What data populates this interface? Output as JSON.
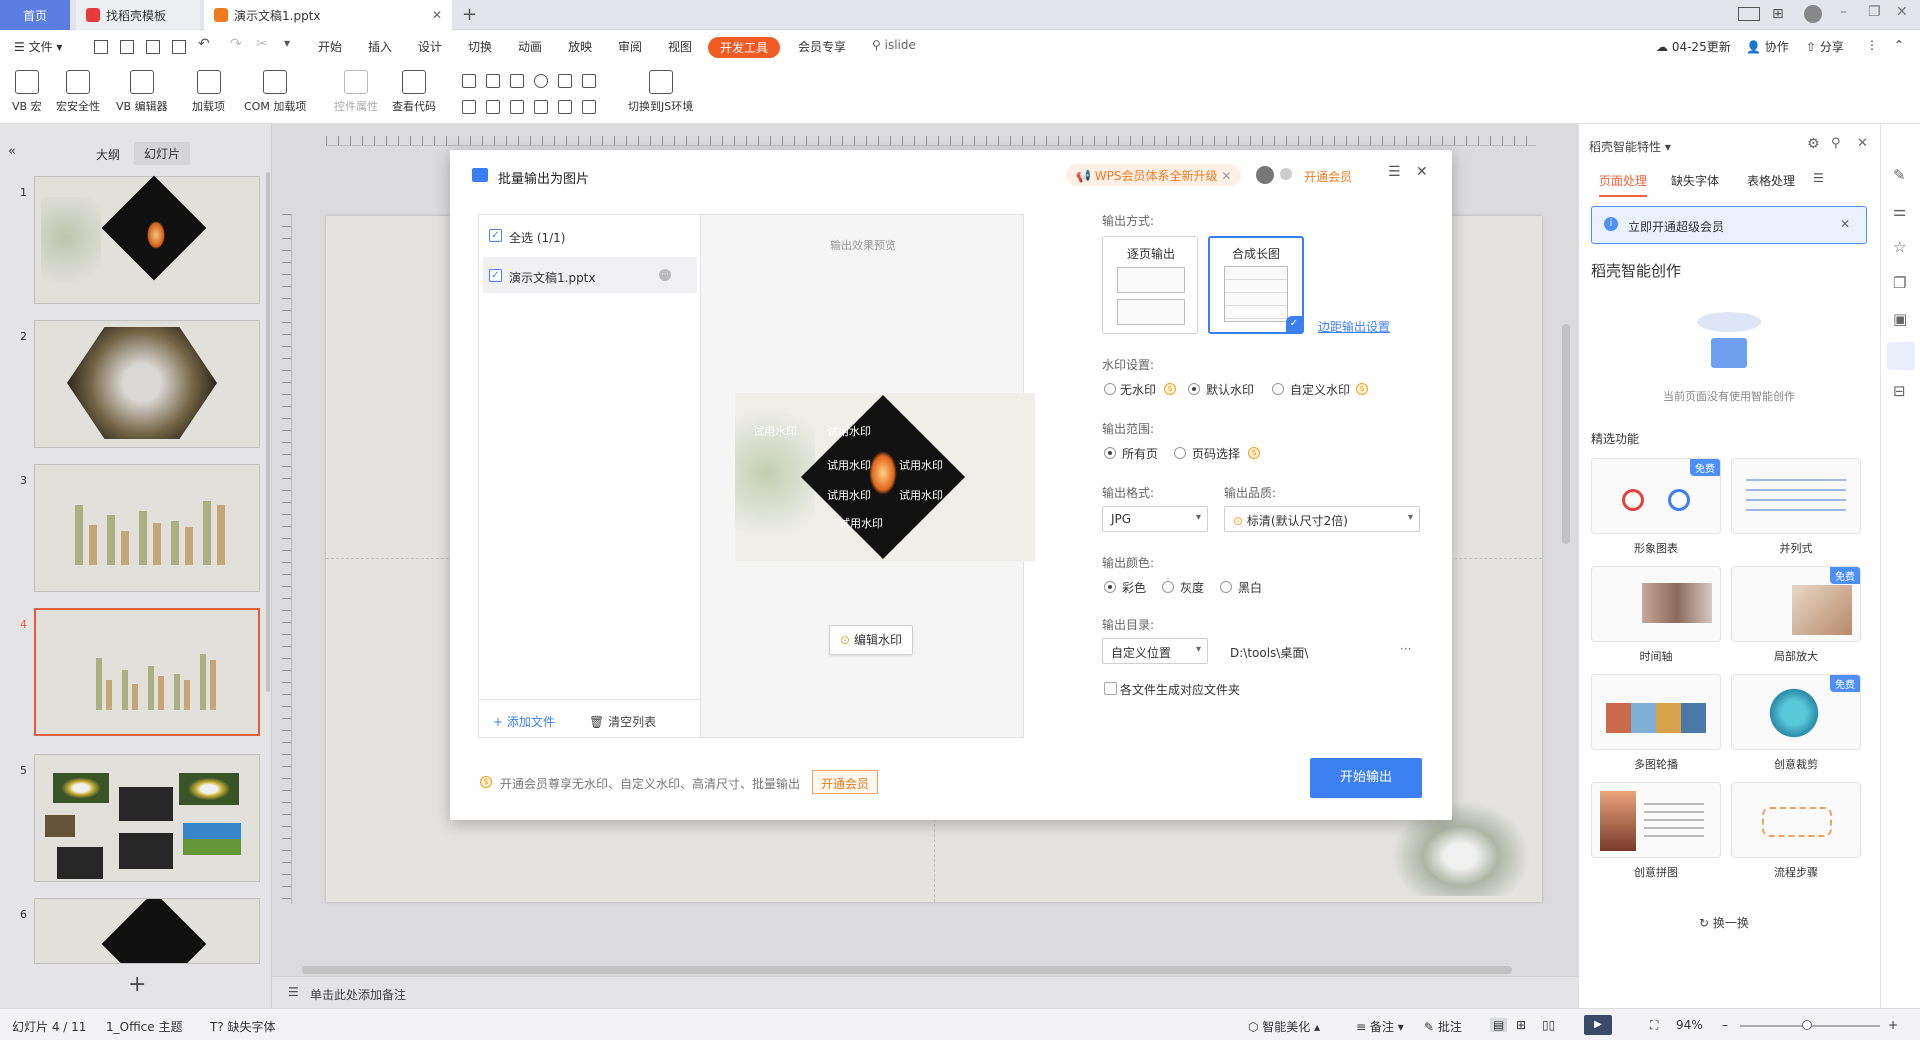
{
  "tabs": {
    "home": "首页",
    "template": "找稻壳模板",
    "doc": "演示文稿1.pptx",
    "add": "+"
  },
  "menu": {
    "file": "文件",
    "items": [
      "开始",
      "插入",
      "设计",
      "切换",
      "动画",
      "放映",
      "审阅",
      "视图"
    ],
    "active": "开发工具",
    "member": "会员专享",
    "search": "islide",
    "update": "04-25更新",
    "collab": "协作",
    "share": "分享"
  },
  "toolbar": {
    "vb_macro": "VB 宏",
    "macro_security": "宏安全性",
    "vb_editor": "VB 编辑器",
    "addins": "加载项",
    "com_addins": "COM 加载项",
    "control_props": "控件属性",
    "view_code": "查看代码",
    "switch_js": "切换到JS环境"
  },
  "leftpanel": {
    "outline_tab": "大纲",
    "slides_tab": "幻灯片",
    "slide_numbers": [
      "1",
      "2",
      "3",
      "4",
      "5",
      "6"
    ]
  },
  "notes_placeholder": "单击此处添加备注",
  "dialog": {
    "title": "批量输出为图片",
    "wps_upgrade": "WPS会员体系全新升级",
    "open_member": "开通会员",
    "select_all": "全选 (1/1)",
    "file_name": "演示文稿1.pptx",
    "add_file": "添加文件",
    "clear_list": "清空列表",
    "preview_label": "输出效果预览",
    "watermark_text": "试用水印",
    "edit_watermark": "编辑水印",
    "output_mode_label": "输出方式:",
    "mode_single": "逐页输出",
    "mode_long": "合成长图",
    "margin_settings": "边距输出设置",
    "watermark_label": "水印设置:",
    "wm_none": "无水印",
    "wm_default": "默认水印",
    "wm_custom": "自定义水印",
    "range_label": "输出范围:",
    "range_all": "所有页",
    "range_pages": "页码选择",
    "format_label": "输出格式:",
    "format_value": "JPG",
    "quality_label": "输出品质:",
    "quality_value": "标清(默认尺寸2倍)",
    "color_label": "输出颜色:",
    "color_color": "彩色",
    "color_gray": "灰度",
    "color_bw": "黑白",
    "dir_label": "输出目录:",
    "dir_select": "自定义位置",
    "dir_path": "D:\\tools\\桌面\\",
    "dir_more": "···",
    "per_file_folder": "各文件生成对应文件夹",
    "footer_text": "开通会员尊享无水印、自定义水印、高清尺寸、批量输出",
    "footer_btn": "开通会员",
    "start_btn": "开始输出"
  },
  "rightpanel": {
    "header": "稻壳智能特性",
    "tabs": [
      "页面处理",
      "缺失字体",
      "表格处理"
    ],
    "banner": "立即开通超级会员",
    "section_title": "稻壳智能创作",
    "empty_text": "当前页面没有使用智能创作",
    "featured": "精选功能",
    "cards": [
      "形象图表",
      "并列式",
      "时间轴",
      "局部放大",
      "多图轮播",
      "创意裁剪",
      "创意拼图",
      "流程步骤"
    ],
    "free_badge": "免费",
    "refresh": "换一换"
  },
  "status": {
    "slide_info": "幻灯片 4 / 11",
    "theme": "1_Office 主题",
    "missing_font": "缺失字体",
    "beautify": "智能美化",
    "notes": "备注",
    "comments": "批注",
    "zoom": "94%"
  },
  "colors": {
    "accent": "#f05a24",
    "primary_blue": "#4e8ef7",
    "dialog_btn": "#3c7ff0",
    "selected_thumb": "#f0643c"
  }
}
